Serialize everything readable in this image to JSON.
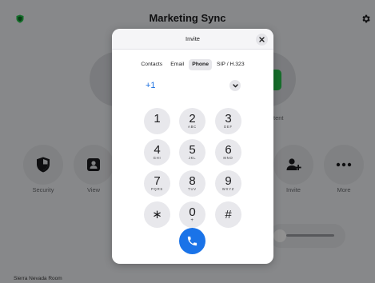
{
  "app": {
    "title": "Marketing Sync",
    "bg_partial_label": "tent",
    "room_name": "Sierra Nevada Room",
    "actions": [
      {
        "name": "security",
        "label": "Security",
        "icon": "shield-icon"
      },
      {
        "name": "view",
        "label": "View",
        "icon": "person-card-icon"
      },
      {
        "name": "invite",
        "label": "Invite",
        "icon": "add-person-icon"
      },
      {
        "name": "more",
        "label": "More",
        "icon": "ellipsis-icon"
      }
    ]
  },
  "modal": {
    "title": "Invite",
    "tabs": [
      {
        "label": "Contacts",
        "active": false
      },
      {
        "label": "Email",
        "active": false
      },
      {
        "label": "Phone",
        "active": true
      },
      {
        "label": "SIP / H.323",
        "active": false
      }
    ],
    "country_code": "+1",
    "keys": [
      {
        "digit": "1",
        "letters": ""
      },
      {
        "digit": "2",
        "letters": "ABC"
      },
      {
        "digit": "3",
        "letters": "DEF"
      },
      {
        "digit": "4",
        "letters": "GHI"
      },
      {
        "digit": "5",
        "letters": "JKL"
      },
      {
        "digit": "6",
        "letters": "MNO"
      },
      {
        "digit": "7",
        "letters": "PQRS"
      },
      {
        "digit": "8",
        "letters": "TUV"
      },
      {
        "digit": "9",
        "letters": "WXYZ"
      },
      {
        "digit": "∗",
        "letters": ""
      },
      {
        "digit": "0",
        "letters": "+"
      },
      {
        "digit": "#",
        "letters": ""
      }
    ]
  },
  "colors": {
    "accent": "#1a73e8",
    "country_code": "#1a6fe0",
    "shield_green": "#27c24c"
  }
}
